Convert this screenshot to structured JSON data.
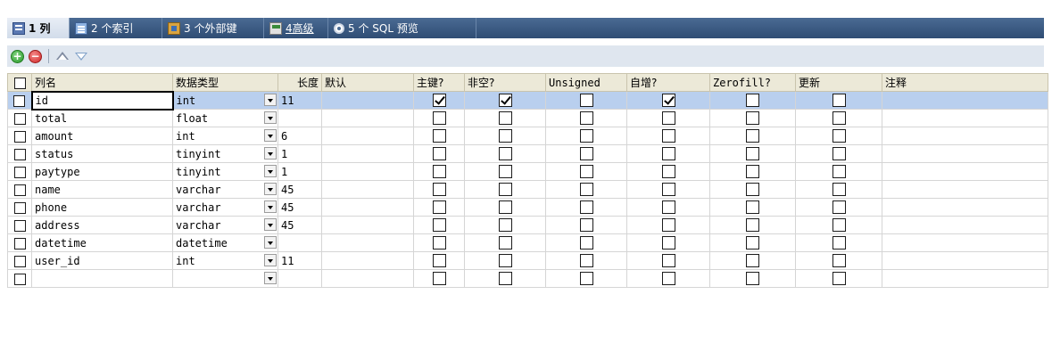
{
  "tabs": [
    {
      "label": "1 列",
      "icon": "grid-icon",
      "active": true
    },
    {
      "label": "2 个索引",
      "icon": "index-icon",
      "active": false
    },
    {
      "label": "3 个外部键",
      "icon": "foreign-key-icon",
      "active": false
    },
    {
      "label": "4高级",
      "icon": "advanced-icon",
      "active": false
    },
    {
      "label": "5 个 SQL 预览",
      "icon": "sql-preview-icon",
      "active": false
    }
  ],
  "toolbar": {
    "add_icon": "add-column-icon",
    "remove_icon": "remove-column-icon",
    "up_icon": "move-up-icon",
    "down_icon": "move-down-icon"
  },
  "columns": [
    "列名",
    "数据类型",
    "长度",
    "默认",
    "主键?",
    "非空?",
    "Unsigned",
    "自增?",
    "Zerofill?",
    "更新",
    "注释"
  ],
  "rows": [
    {
      "name": "id",
      "type": "int",
      "length": "11",
      "default": "",
      "pk": true,
      "notnull": true,
      "unsigned": false,
      "autoinc": true,
      "zerofill": false,
      "update": false,
      "comment": ""
    },
    {
      "name": "total",
      "type": "float",
      "length": "",
      "default": "",
      "pk": false,
      "notnull": false,
      "unsigned": false,
      "autoinc": false,
      "zerofill": false,
      "update": false,
      "comment": ""
    },
    {
      "name": "amount",
      "type": "int",
      "length": "6",
      "default": "",
      "pk": false,
      "notnull": false,
      "unsigned": false,
      "autoinc": false,
      "zerofill": false,
      "update": false,
      "comment": ""
    },
    {
      "name": "status",
      "type": "tinyint",
      "length": "1",
      "default": "",
      "pk": false,
      "notnull": false,
      "unsigned": false,
      "autoinc": false,
      "zerofill": false,
      "update": false,
      "comment": ""
    },
    {
      "name": "paytype",
      "type": "tinyint",
      "length": "1",
      "default": "",
      "pk": false,
      "notnull": false,
      "unsigned": false,
      "autoinc": false,
      "zerofill": false,
      "update": false,
      "comment": ""
    },
    {
      "name": "name",
      "type": "varchar",
      "length": "45",
      "default": "",
      "pk": false,
      "notnull": false,
      "unsigned": false,
      "autoinc": false,
      "zerofill": false,
      "update": false,
      "comment": ""
    },
    {
      "name": "phone",
      "type": "varchar",
      "length": "45",
      "default": "",
      "pk": false,
      "notnull": false,
      "unsigned": false,
      "autoinc": false,
      "zerofill": false,
      "update": false,
      "comment": ""
    },
    {
      "name": "address",
      "type": "varchar",
      "length": "45",
      "default": "",
      "pk": false,
      "notnull": false,
      "unsigned": false,
      "autoinc": false,
      "zerofill": false,
      "update": false,
      "comment": ""
    },
    {
      "name": "datetime",
      "type": "datetime",
      "length": "",
      "default": "",
      "pk": false,
      "notnull": false,
      "unsigned": false,
      "autoinc": false,
      "zerofill": false,
      "update": false,
      "comment": ""
    },
    {
      "name": "user_id",
      "type": "int",
      "length": "11",
      "default": "",
      "pk": false,
      "notnull": false,
      "unsigned": false,
      "autoinc": false,
      "zerofill": false,
      "update": false,
      "comment": ""
    },
    {
      "name": "",
      "type": "",
      "length": "",
      "default": "",
      "pk": false,
      "notnull": false,
      "unsigned": false,
      "autoinc": false,
      "zerofill": false,
      "update": false,
      "comment": ""
    }
  ],
  "selected_row": 0,
  "colors": {
    "tab_bar": "#3d5a80",
    "toolbar": "#dfe6ef",
    "header": "#ece9d8",
    "selected_row": "#b9cfee"
  }
}
